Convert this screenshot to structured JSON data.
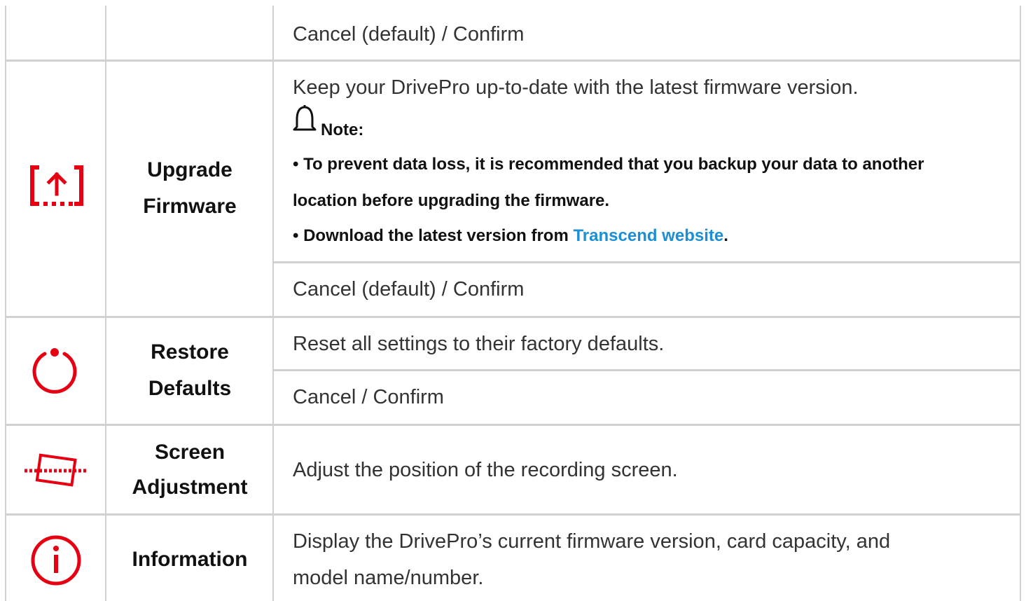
{
  "rows": [
    {
      "option": "",
      "values": [
        "Cancel (default) / Confirm"
      ]
    },
    {
      "icon": "upgrade-firmware-icon",
      "name_line1": "Upgrade",
      "name_line2": "Firmware",
      "description": "Keep your DrivePro up-to-date with the latest firmware version.",
      "note_label": "Note:",
      "note_line1": "• To prevent data loss, it is recommended that you backup your data to another",
      "note_line2": "location before upgrading the firmware.",
      "note_line3_prefix": "• Download the latest version from ",
      "note_link": "Transcend website",
      "note_line3_suffix": ".",
      "options": "Cancel (default) / Confirm"
    },
    {
      "icon": "restore-defaults-icon",
      "name_line1": "Restore",
      "name_line2": "Defaults",
      "description": "Reset all settings to their factory defaults.",
      "options": "Cancel / Confirm"
    },
    {
      "icon": "screen-adjustment-icon",
      "name_line1": "Screen",
      "name_line2": "Adjustment",
      "description": "Adjust the position of the recording screen."
    },
    {
      "icon": "information-icon",
      "name": "Information",
      "description_line1": "Display the DrivePro’s current firmware version, card capacity, and",
      "description_line2": "model name/number."
    }
  ],
  "colors": {
    "icon_red": "#e60012",
    "border": "#d0d0d0",
    "link": "#1a8fd6"
  }
}
